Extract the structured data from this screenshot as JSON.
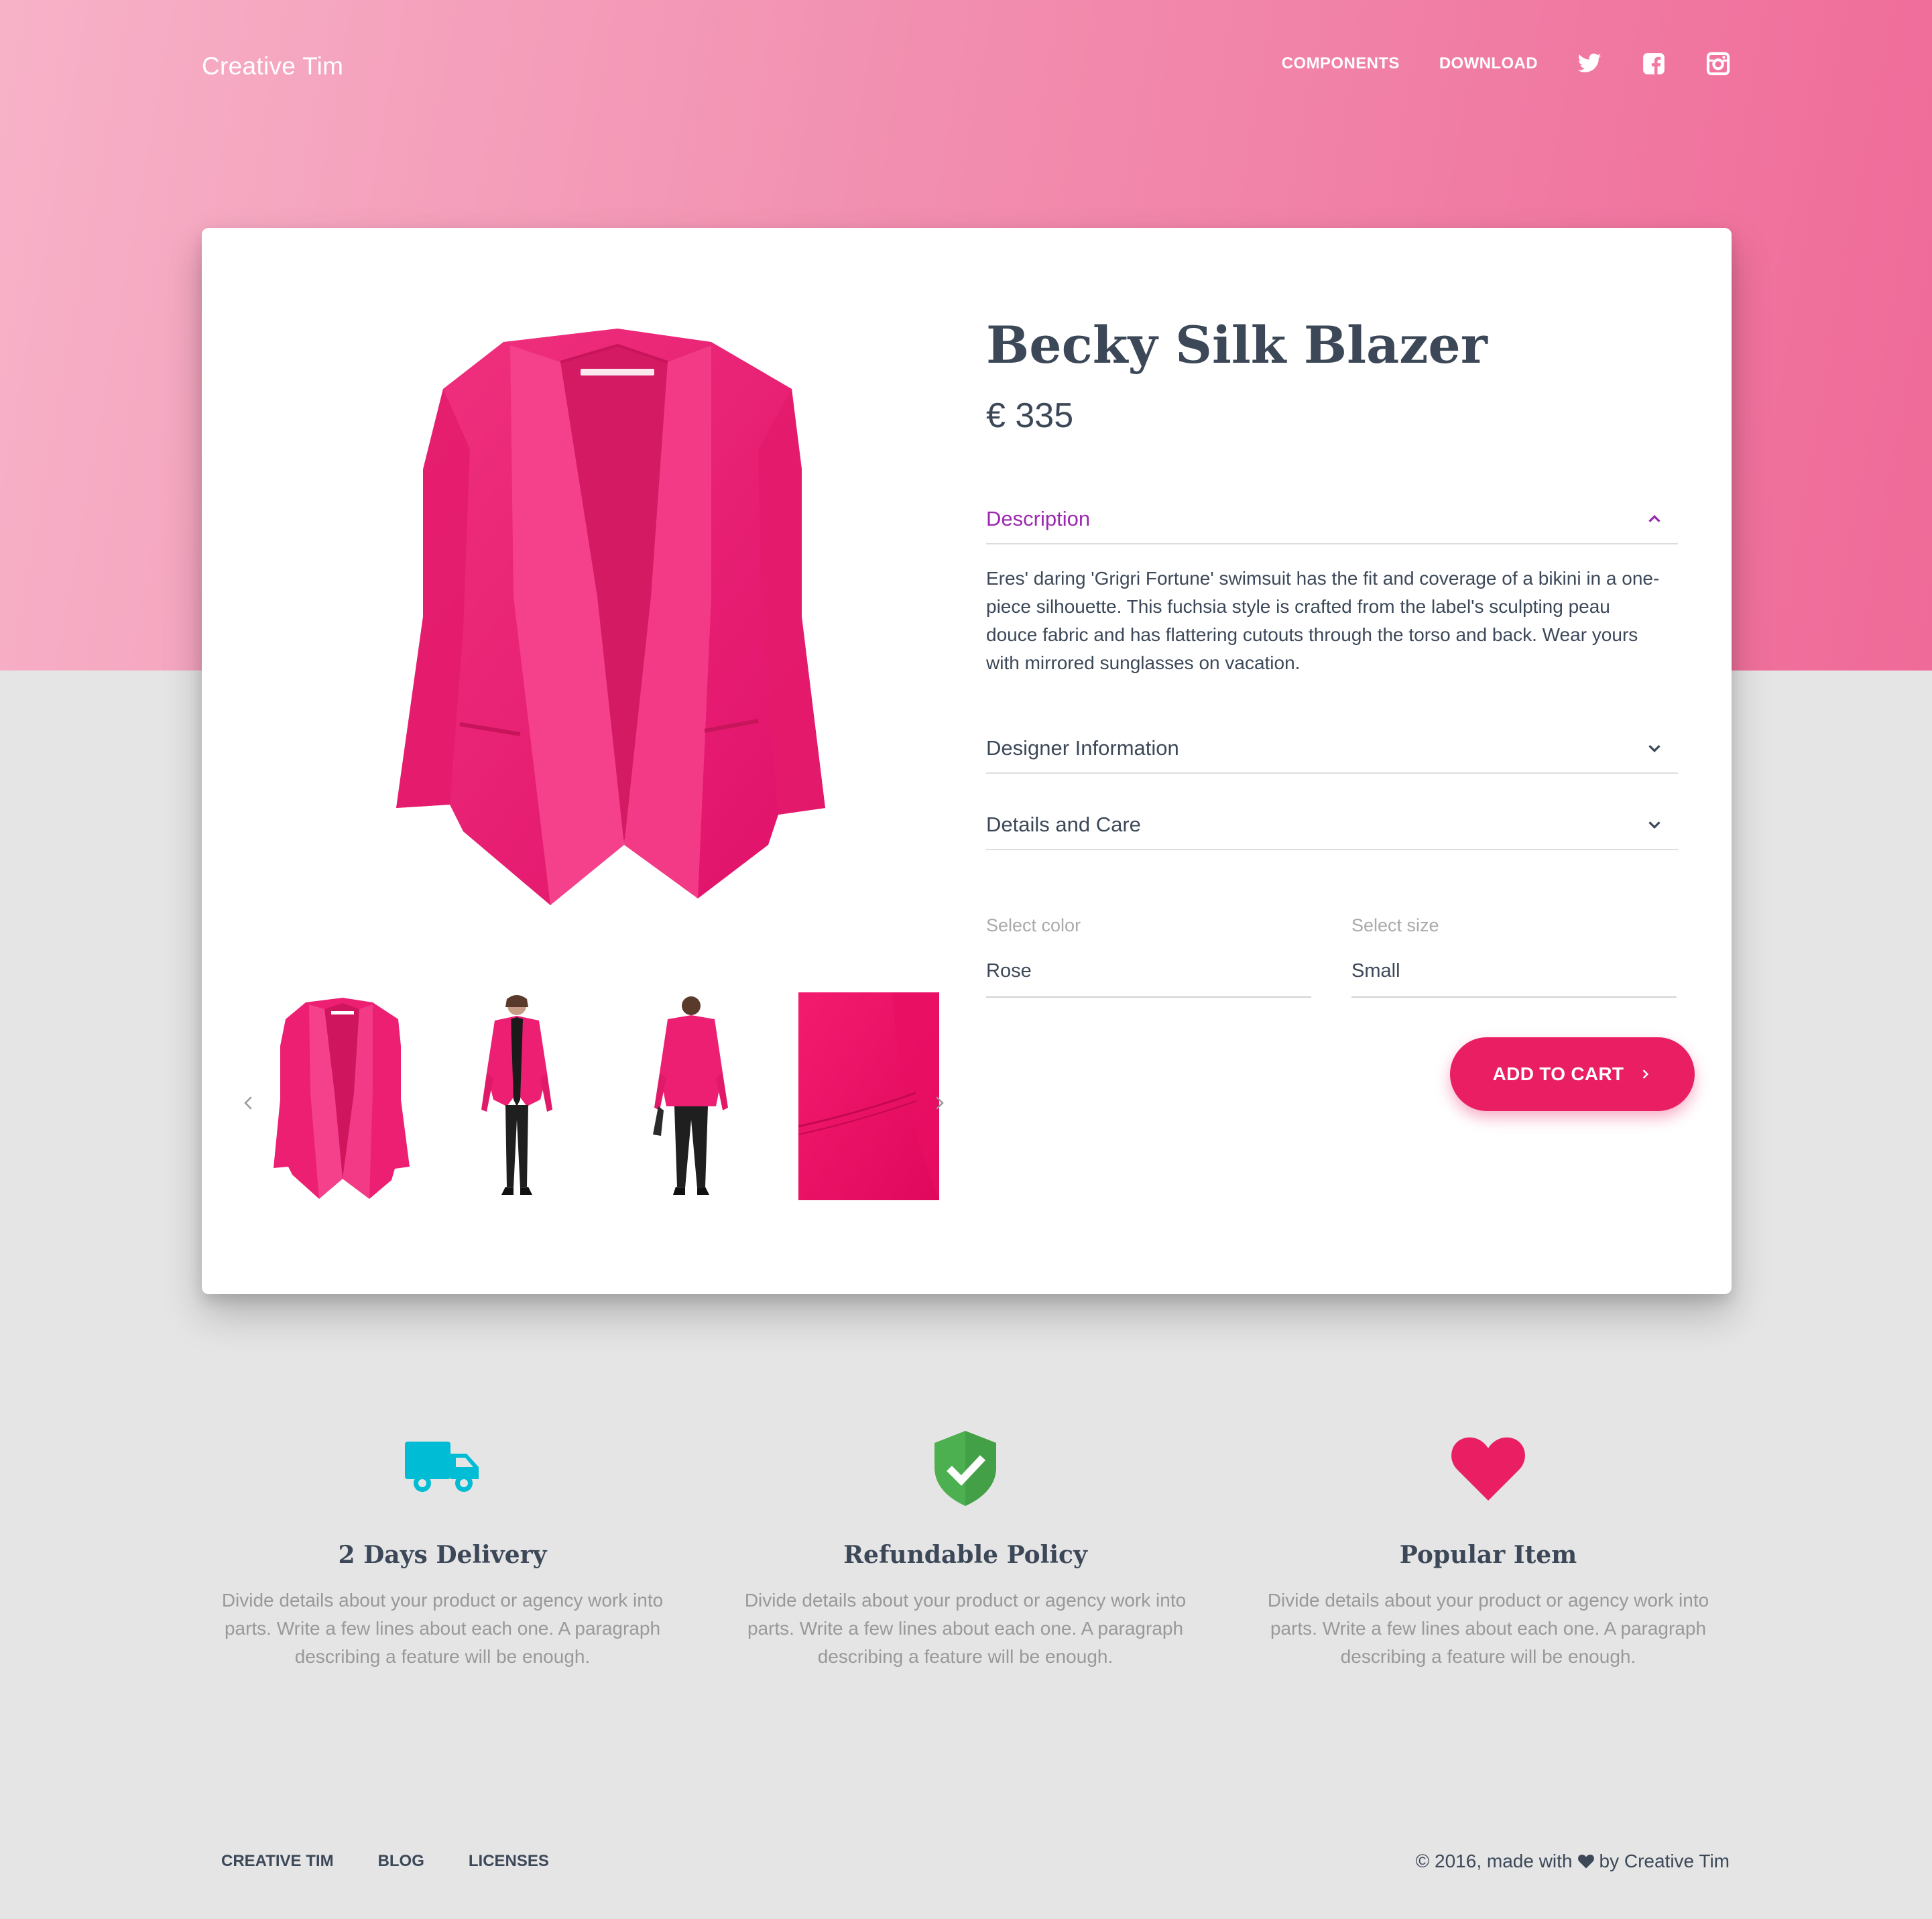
{
  "nav": {
    "brand": "Creative Tim",
    "links": [
      "Components",
      "Download"
    ],
    "social_icons": [
      "twitter-icon",
      "facebook-icon",
      "instagram-icon"
    ]
  },
  "product": {
    "title": "Becky Silk Blazer",
    "price": "€ 335",
    "images": {
      "main": "pink-blazer-front",
      "thumbnails": [
        "pink-blazer-flat",
        "model-wearing-blazer-front",
        "model-wearing-blazer-back",
        "blazer-fabric-closeup"
      ]
    },
    "accordion": [
      {
        "title": "Description",
        "expanded": true,
        "body": "Eres' daring 'Grigri Fortune' swimsuit has the fit and coverage of a bikini in a one-piece silhouette. This fuchsia style is crafted from the label's sculpting peau douce fabric and has flattering cutouts through the torso and back. Wear yours with mirrored sunglasses on vacation."
      },
      {
        "title": "Designer Information",
        "expanded": false
      },
      {
        "title": "Details and Care",
        "expanded": false
      }
    ],
    "select_color": {
      "label": "Select color",
      "value": "Rose"
    },
    "select_size": {
      "label": "Select size",
      "value": "Small"
    },
    "add_to_cart": "Add to Cart"
  },
  "features": [
    {
      "icon": "truck-icon",
      "title": "2 Days Delivery",
      "text": "Divide details about your product or agency work into parts. Write a few lines about each one. A paragraph describing a feature will be enough."
    },
    {
      "icon": "shield-check-icon",
      "title": "Refundable Policy",
      "text": "Divide details about your product or agency work into parts. Write a few lines about each one. A paragraph describing a feature will be enough."
    },
    {
      "icon": "heart-icon",
      "title": "Popular Item",
      "text": "Divide details about your product or agency work into parts. Write a few lines about each one. A paragraph describing a feature will be enough."
    }
  ],
  "footer": {
    "links": [
      "Creative Tim",
      "Blog",
      "Licenses"
    ],
    "copyright_prefix": "© 2016, made with",
    "copyright_suffix": "by Creative Tim"
  },
  "colors": {
    "accent": "#e91e63",
    "purple": "#9c27b0",
    "truck": "#00bcd4",
    "shield": "#4caf50",
    "heart": "#e91e63",
    "text": "#3c4858",
    "muted": "#999999"
  }
}
